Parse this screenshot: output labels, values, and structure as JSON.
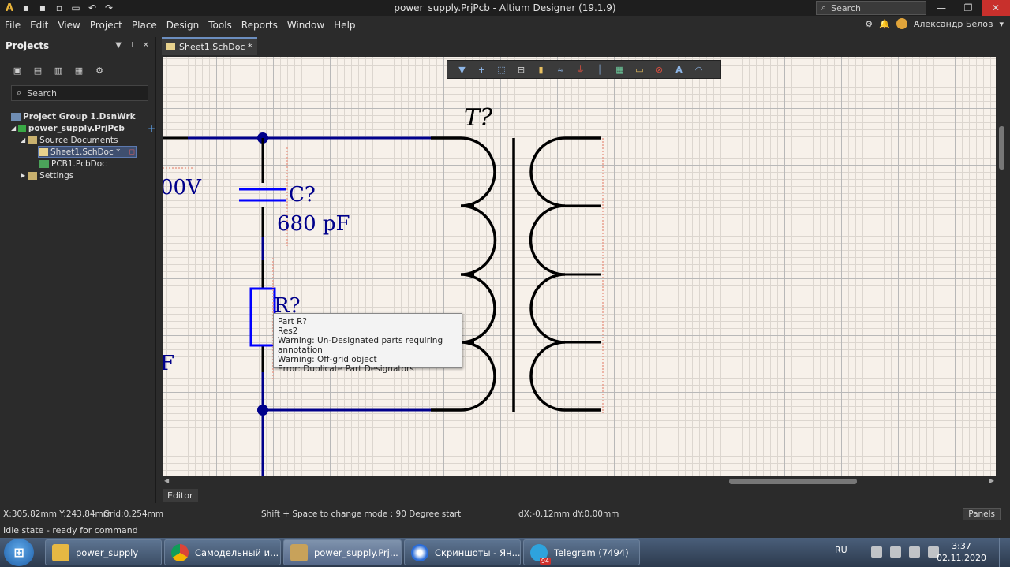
{
  "window": {
    "title": "power_supply.PrjPcb - Altium Designer (19.1.9)",
    "search_placeholder": "Search",
    "user": "Александр Белов"
  },
  "menu": [
    "File",
    "Edit",
    "View",
    "Project",
    "Place",
    "Design",
    "Tools",
    "Reports",
    "Window",
    "Help"
  ],
  "panel": {
    "title": "Projects",
    "search_placeholder": "Search",
    "tree": {
      "group": "Project Group 1.DsnWrk",
      "project": "power_supply.PrjPcb",
      "source_folder": "Source Documents",
      "sheet": "Sheet1.SchDoc *",
      "pcb": "PCB1.PcbDoc",
      "settings": "Settings"
    }
  },
  "tabs": {
    "document": "Sheet1.SchDoc *",
    "editor": "Editor"
  },
  "schematic": {
    "transformer_designator": "T?",
    "capacitor_designator": "C?",
    "capacitor_value": "680 pF",
    "resistor_designator": "R?",
    "left_voltage_fragment": "00V",
    "left_fragment_2": "F",
    "wire_color": "#00008b",
    "component_color": "#0000ff"
  },
  "tooltip": {
    "lines": [
      "Part R?",
      "Res2",
      "Warning: Un-Designated parts requiring annotation",
      "Warning: Off-grid object",
      "Error: Duplicate Part Designators"
    ]
  },
  "status": {
    "coords": "X:305.82mm Y:243.84mm",
    "grid": "Grid:0.254mm",
    "hint": "Shift + Space to change mode : 90 Degree start",
    "delta": "dX:-0.12mm dY:0.00mm",
    "panels_button": "Panels",
    "idle": "Idle state - ready for command"
  },
  "taskbar": {
    "items": [
      {
        "label": "power_supply",
        "icon": "folder-icon"
      },
      {
        "label": "Самодельный и...",
        "icon": "chrome-icon"
      },
      {
        "label": "power_supply.Prj...",
        "icon": "altium-icon"
      },
      {
        "label": "Скриншоты - Ян...",
        "icon": "yandex-browser-icon"
      },
      {
        "label": "Telegram (7494)",
        "icon": "telegram-icon",
        "badge": "94"
      }
    ],
    "lang": "RU",
    "time": "3:37",
    "date": "02.11.2020"
  }
}
